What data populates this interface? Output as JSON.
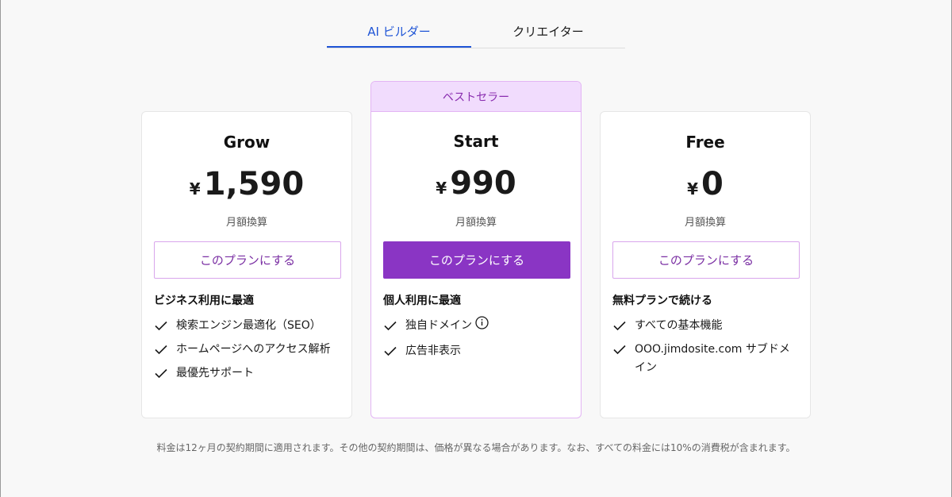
{
  "tabs": [
    {
      "label": "AI ビルダー",
      "active": true
    },
    {
      "label": "クリエイター",
      "active": false
    }
  ],
  "colors": {
    "accent_tab": "#1f55d6",
    "purple": "#8a35c4",
    "badge_bg": "#f1dcfd"
  },
  "plans": [
    {
      "name": "Grow",
      "currency": "¥",
      "price": "1,590",
      "period": "月額換算",
      "cta": "このプランにする",
      "feature_title": "ビジネス利用に最適",
      "features": [
        "検索エンジン最適化（SEO）",
        "ホームページへのアクセス解析",
        "最優先サポート"
      ]
    },
    {
      "name": "Start",
      "badge": "ベストセラー",
      "currency": "¥",
      "price": "990",
      "period": "月額換算",
      "cta": "このプランにする",
      "feature_title": "個人利用に最適",
      "features": [
        "独自ドメイン",
        "広告非表示"
      ]
    },
    {
      "name": "Free",
      "currency": "¥",
      "price": "0",
      "period": "月額換算",
      "cta": "このプランにする",
      "feature_title": "無料プランで続ける",
      "features": [
        "すべての基本機能",
        "OOO.jimdosite.com サブドメイン"
      ]
    }
  ],
  "footnote": "料金は12ヶ月の契約期間に適用されます。その他の契約期間は、価格が異なる場合があります。なお、すべての料金には10%の消費税が含まれます。"
}
